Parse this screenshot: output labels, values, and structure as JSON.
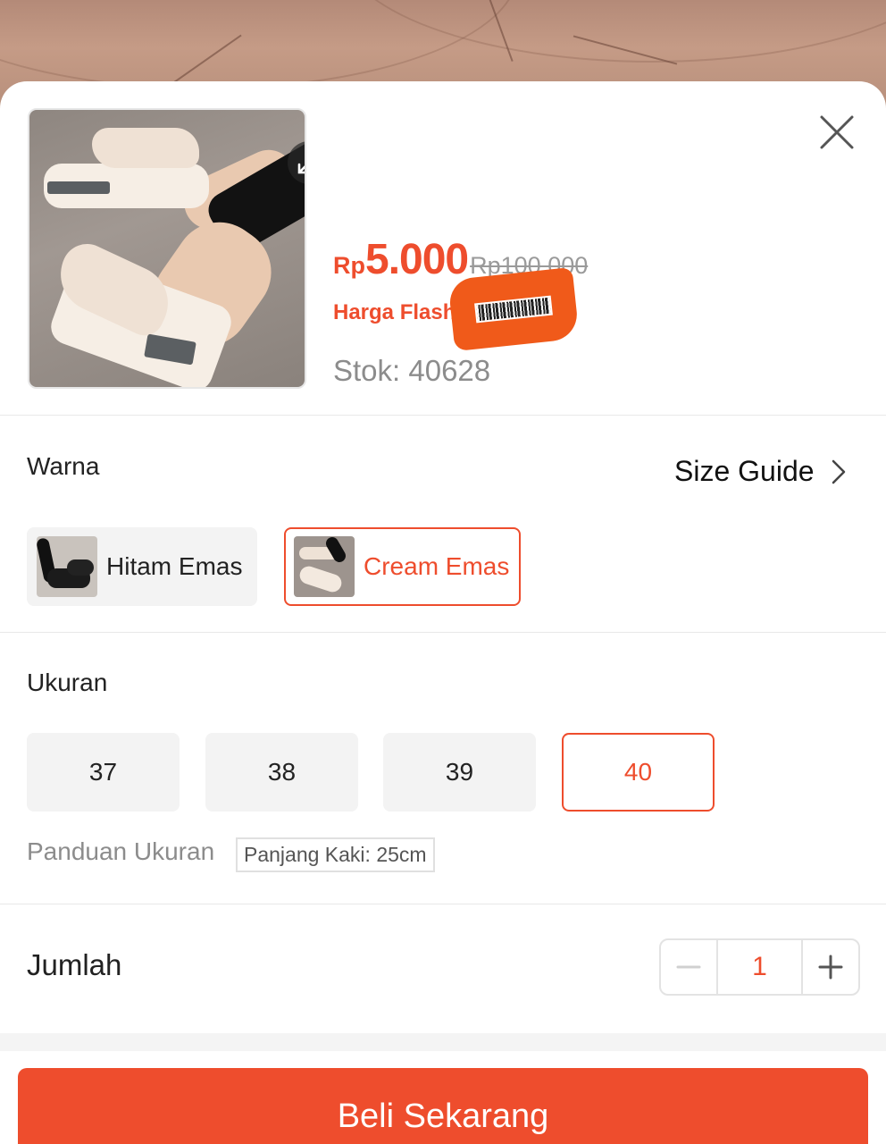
{
  "product": {
    "price_currency": "Rp",
    "price_value": "5.000",
    "price_original": "Rp100.000",
    "flash_label": "Harga Flash",
    "stock_text": "Stok: 40628"
  },
  "variations": {
    "color_title": "Warna",
    "size_guide_label": "Size Guide",
    "colors": [
      {
        "label": "Hitam Emas",
        "selected": false
      },
      {
        "label": "Cream Emas",
        "selected": true
      }
    ],
    "size_title": "Ukuran",
    "sizes": [
      {
        "label": "37",
        "selected": false
      },
      {
        "label": "38",
        "selected": false
      },
      {
        "label": "39",
        "selected": false
      },
      {
        "label": "40",
        "selected": true
      }
    ],
    "size_note_label": "Panduan Ukuran",
    "size_note_value": "Panjang Kaki: 25cm"
  },
  "quantity": {
    "label": "Jumlah",
    "value": "1"
  },
  "actions": {
    "buy_label": "Beli Sekarang"
  },
  "icons": {
    "close": "close-icon",
    "expand": "expand-icon",
    "chevron": "chevron-right-icon",
    "minus": "minus-icon",
    "plus": "plus-icon"
  },
  "colors": {
    "accent": "#ee4d2d",
    "muted_text": "#8c8c8c",
    "chip_bg": "#f3f3f3"
  }
}
